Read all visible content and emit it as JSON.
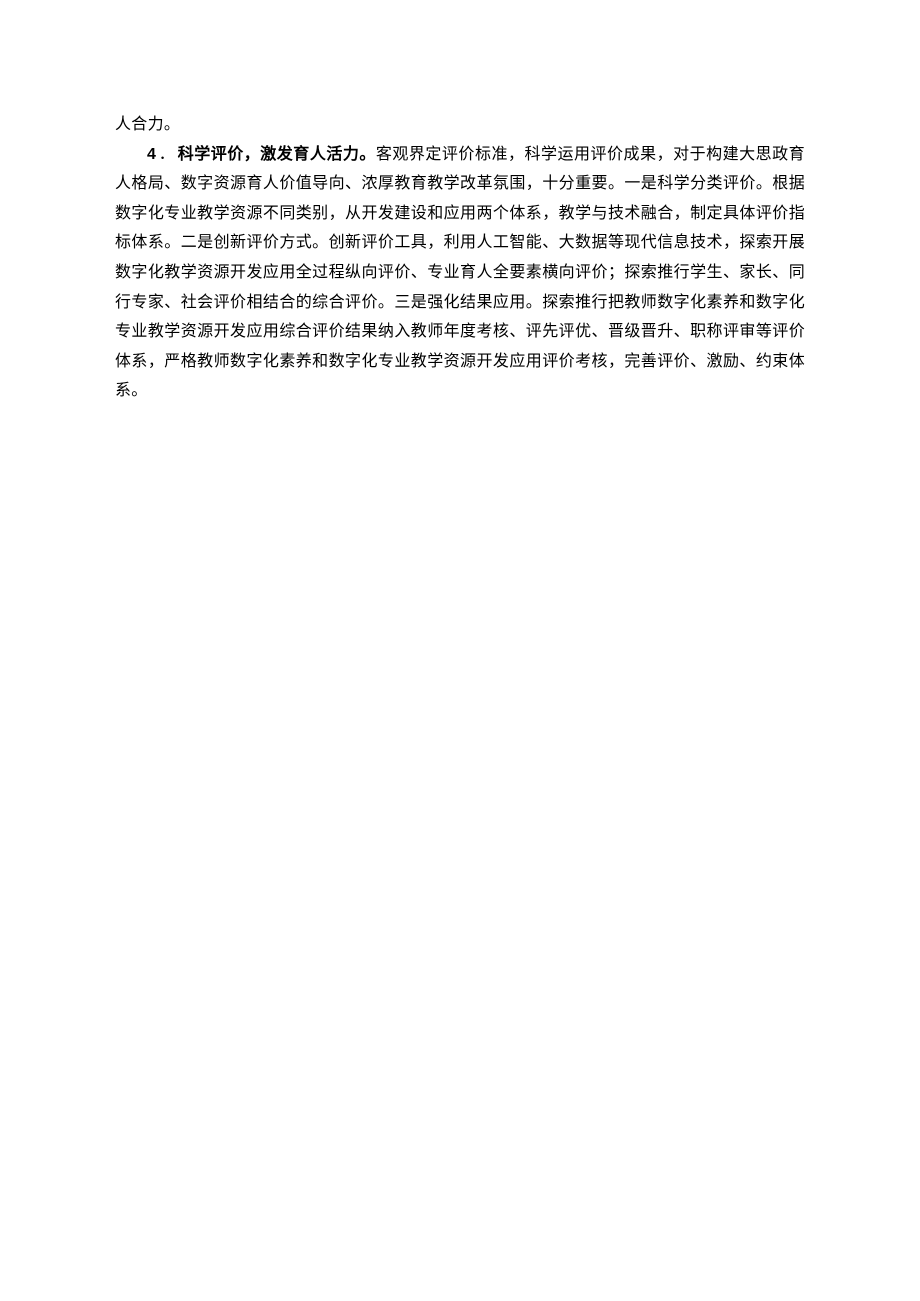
{
  "continuation_text": "人合力。",
  "paragraph": {
    "number": "4",
    "separator": "．",
    "heading": "科学评价，激发育人活力。",
    "body": "客观界定评价标准，科学运用评价成果，对于构建大思政育人格局、数字资源育人价值导向、浓厚教育教学改革氛围，十分重要。一是科学分类评价。根据数字化专业教学资源不同类别，从开发建设和应用两个体系，教学与技术融合，制定具体评价指标体系。二是创新评价方式。创新评价工具，利用人工智能、大数据等现代信息技术，探索开展数字化教学资源开发应用全过程纵向评价、专业育人全要素横向评价；探索推行学生、家长、同行专家、社会评价相结合的综合评价。三是强化结果应用。探索推行把教师数字化素养和数字化专业教学资源开发应用综合评价结果纳入教师年度考核、评先评优、晋级晋升、职称评审等评价体系，严格教师数字化素养和数字化专业教学资源开发应用评价考核，完善评价、激励、约束体系。"
  }
}
